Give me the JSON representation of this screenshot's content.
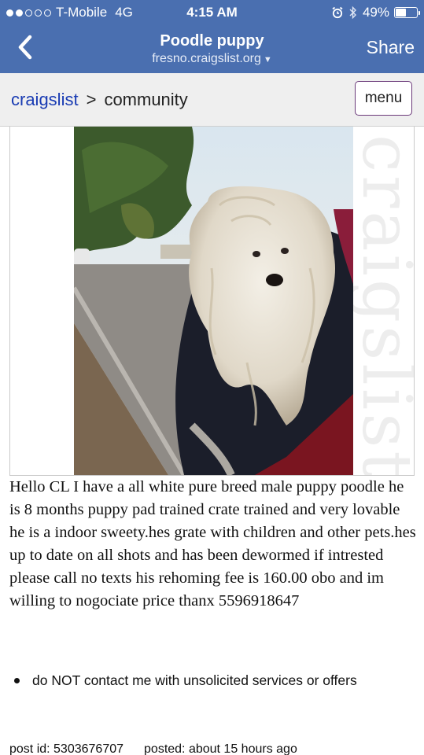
{
  "status_bar": {
    "carrier": "T-Mobile",
    "network": "4G",
    "time": "4:15 AM",
    "battery": "49%",
    "battery_level": 0.49,
    "signal_bars": 2
  },
  "nav": {
    "title": "Poodle puppy",
    "subtitle": "fresno.craigslist.org",
    "share_label": "Share",
    "back_icon": "chevron-left-icon"
  },
  "breadcrumb": {
    "site": "craigslist",
    "separator": ">",
    "section": "community",
    "menu_label": "menu"
  },
  "posting": {
    "watermark": "craigslist",
    "body": "Hello CL I have a all white pure breed male puppy poodle he is 8 months puppy pad trained crate trained and very lovable he is a indoor sweety.hes grate with children and other pets.hes up to date on all shots and has been dewormed if intrested please call no texts his rehoming fee is 160.00 obo and im willing to nogociate price thanx 5596918647",
    "notice": "do NOT contact me with unsolicited services or offers",
    "post_id": "post id: 5303676707",
    "posted": "posted: about 15 hours ago"
  },
  "colors": {
    "nav_bg": "#4a6fb0",
    "link": "#1a3cb3",
    "menu_border": "#6b3a7a"
  }
}
